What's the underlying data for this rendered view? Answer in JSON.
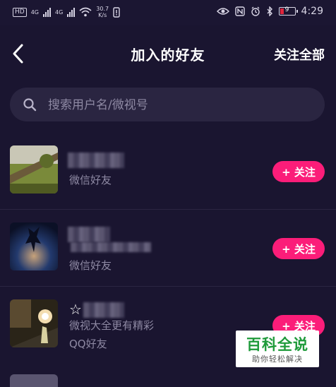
{
  "status_bar": {
    "network_badge": "HD",
    "signal_1": "4G",
    "signal_2": "4G",
    "speed_value": "30.7",
    "speed_unit": "K/s",
    "battery_level": "9",
    "time": "4:29"
  },
  "nav": {
    "title": "加入的好友",
    "follow_all_label": "关注全部"
  },
  "search": {
    "placeholder": "搜索用户名/微视号"
  },
  "friends": [
    {
      "subtitle": "微信好友",
      "button_label": "+ 关注"
    },
    {
      "subtitle": "微信好友",
      "button_label": "+ 关注"
    },
    {
      "name_partial": "☆",
      "bio": "微视大全更有精彩",
      "subtitle": "QQ好友",
      "button_label": "+ 关注"
    }
  ],
  "watermark": {
    "main": "百科全说",
    "sub": "助你轻松解决"
  },
  "colors": {
    "background": "#1a1530",
    "accent": "#fb1d79",
    "muted_text": "#8e89a3"
  }
}
